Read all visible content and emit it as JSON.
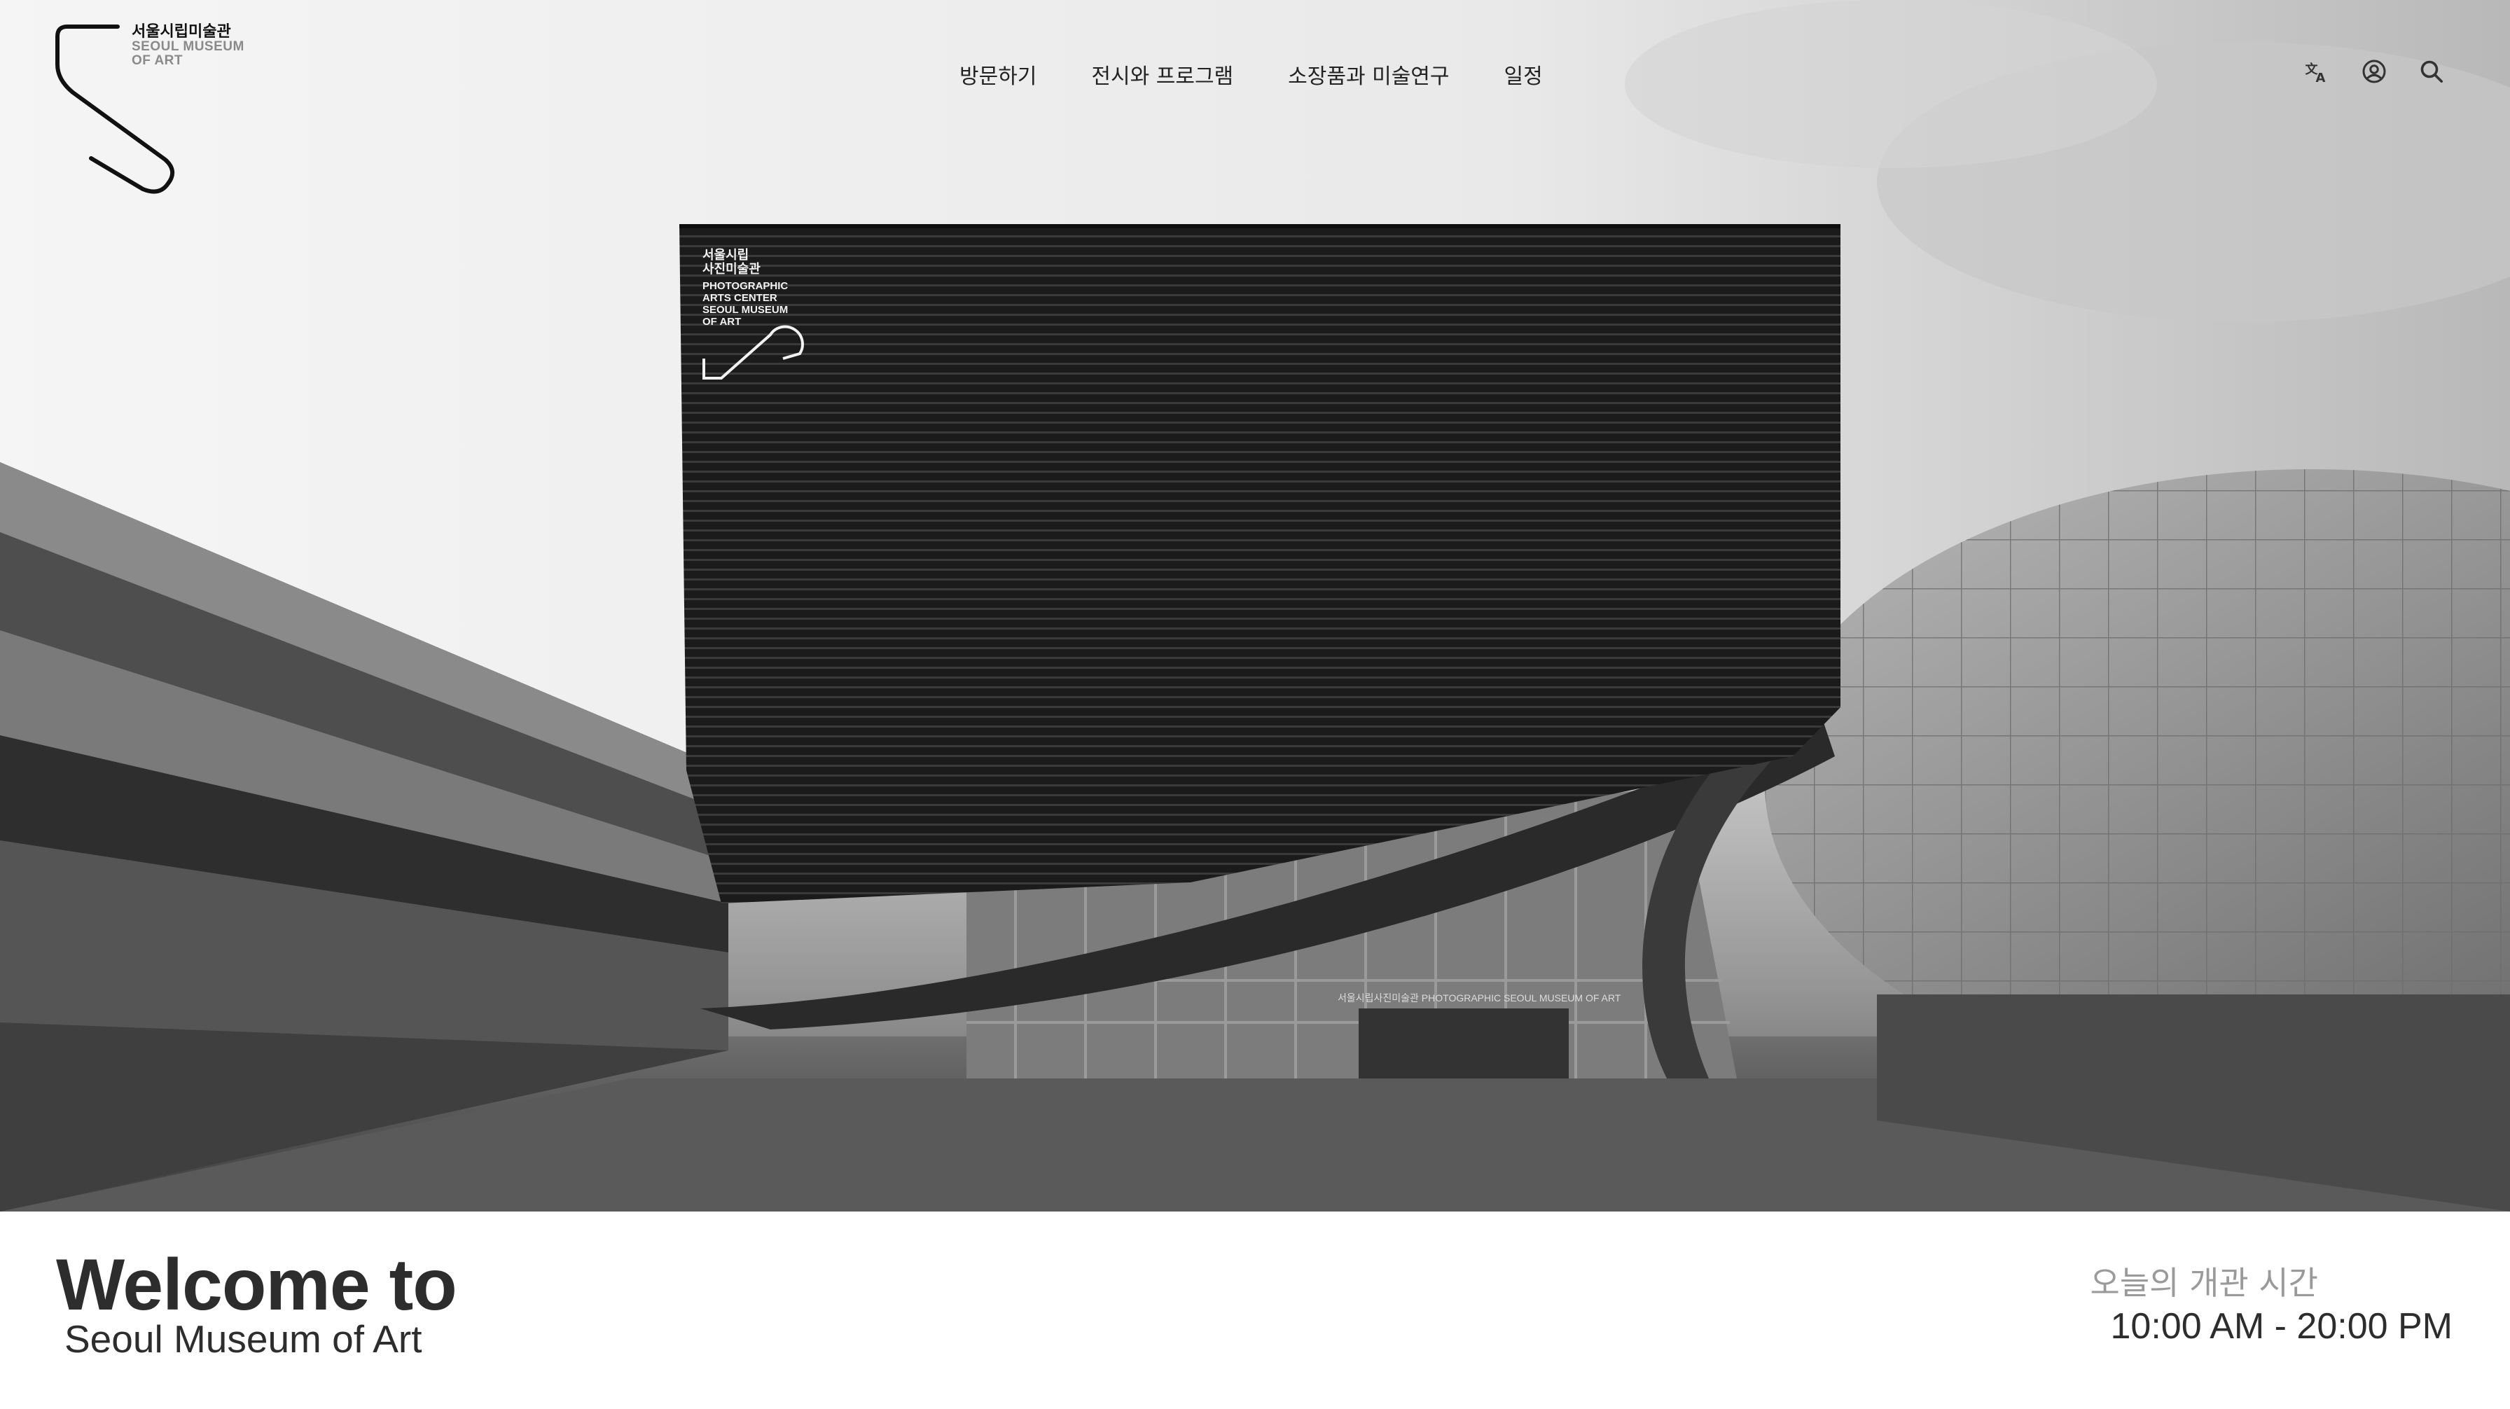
{
  "logo": {
    "korean": "서울시립미술관",
    "english_line1": "SEOUL MUSEUM",
    "english_line2": "OF ART"
  },
  "nav": {
    "items": [
      {
        "label": "방문하기"
      },
      {
        "label": "전시와 프로그램"
      },
      {
        "label": "소장품과 미술연구"
      },
      {
        "label": "일정"
      }
    ]
  },
  "utility": {
    "icons": [
      "language-icon",
      "user-icon",
      "search-icon"
    ]
  },
  "hero": {
    "building_sign": {
      "korean_line1": "서울시립",
      "korean_line2": "사진미술관",
      "english_lines": [
        "PHOTOGRAPHIC",
        "ARTS CENTER",
        "SEOUL MUSEUM",
        "OF ART"
      ]
    },
    "entrance_sign": "서울시립사진미술관 PHOTOGRAPHIC SEOUL MUSEUM OF ART"
  },
  "welcome": {
    "title": "Welcome to",
    "subtitle": "Seoul Museum of Art"
  },
  "hours": {
    "label": "오늘의 개관 시간",
    "value": "10:00 AM - 20:00 PM"
  },
  "colors": {
    "text_dark": "#2d2d2d",
    "text_muted": "#9a9a9a",
    "building": "#1e1e1e"
  }
}
